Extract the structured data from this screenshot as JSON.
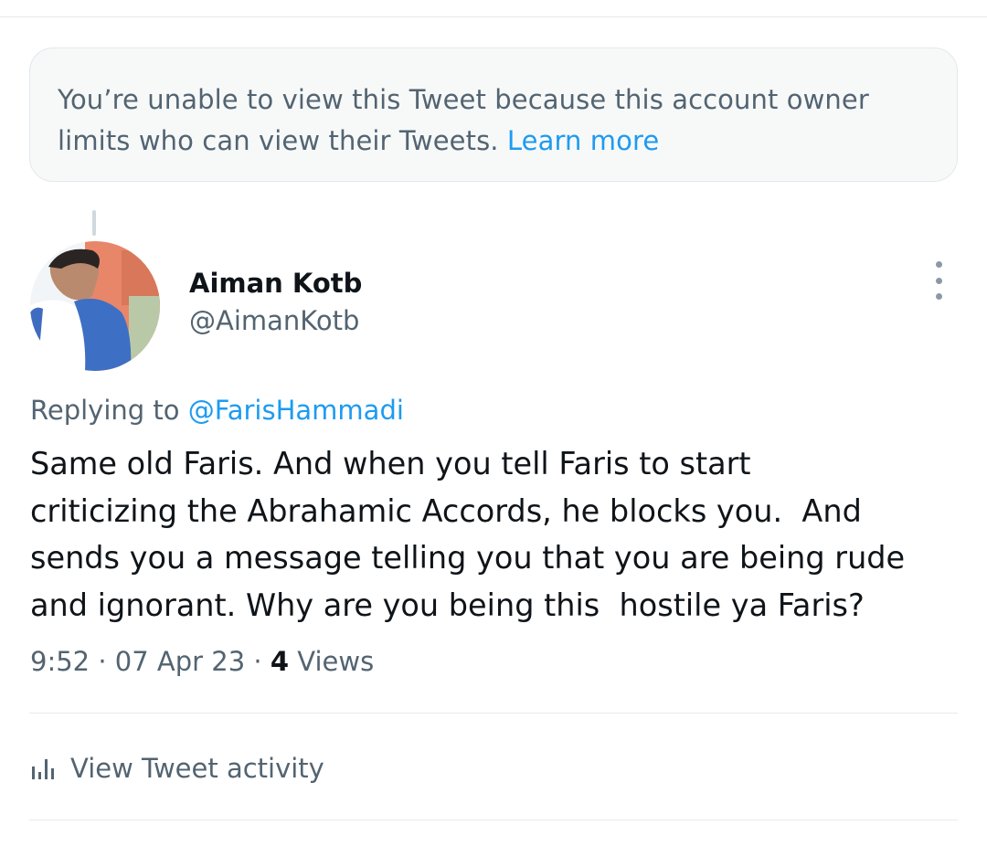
{
  "notice": {
    "text": "You’re unable to view this Tweet because this account owner limits who can view their Tweets.",
    "link": "Learn more"
  },
  "tweet": {
    "display_name": "Aiman Kotb",
    "handle": "@AimanKotb",
    "replying_prefix": "Replying to",
    "replying_to": "@FarisHammadi",
    "text": "Same old Faris. And when you tell Faris to start\ncriticizing the Abrahamic Accords, he blocks you.  And\nsends you a message telling you that you are being rude\nand ignorant. Why are you being this  hostile ya Faris?",
    "time": "9:52",
    "sep": "·",
    "date": "07 Apr 23",
    "views_count": "4",
    "views_label": "Views"
  },
  "activity": {
    "label": "View Tweet activity",
    "icon": "bar-chart-icon"
  },
  "colors": {
    "accent": "#1d9bf0",
    "secondary_text": "#536471",
    "primary_text": "#0f1419",
    "notice_bg": "#f7f9f9"
  }
}
